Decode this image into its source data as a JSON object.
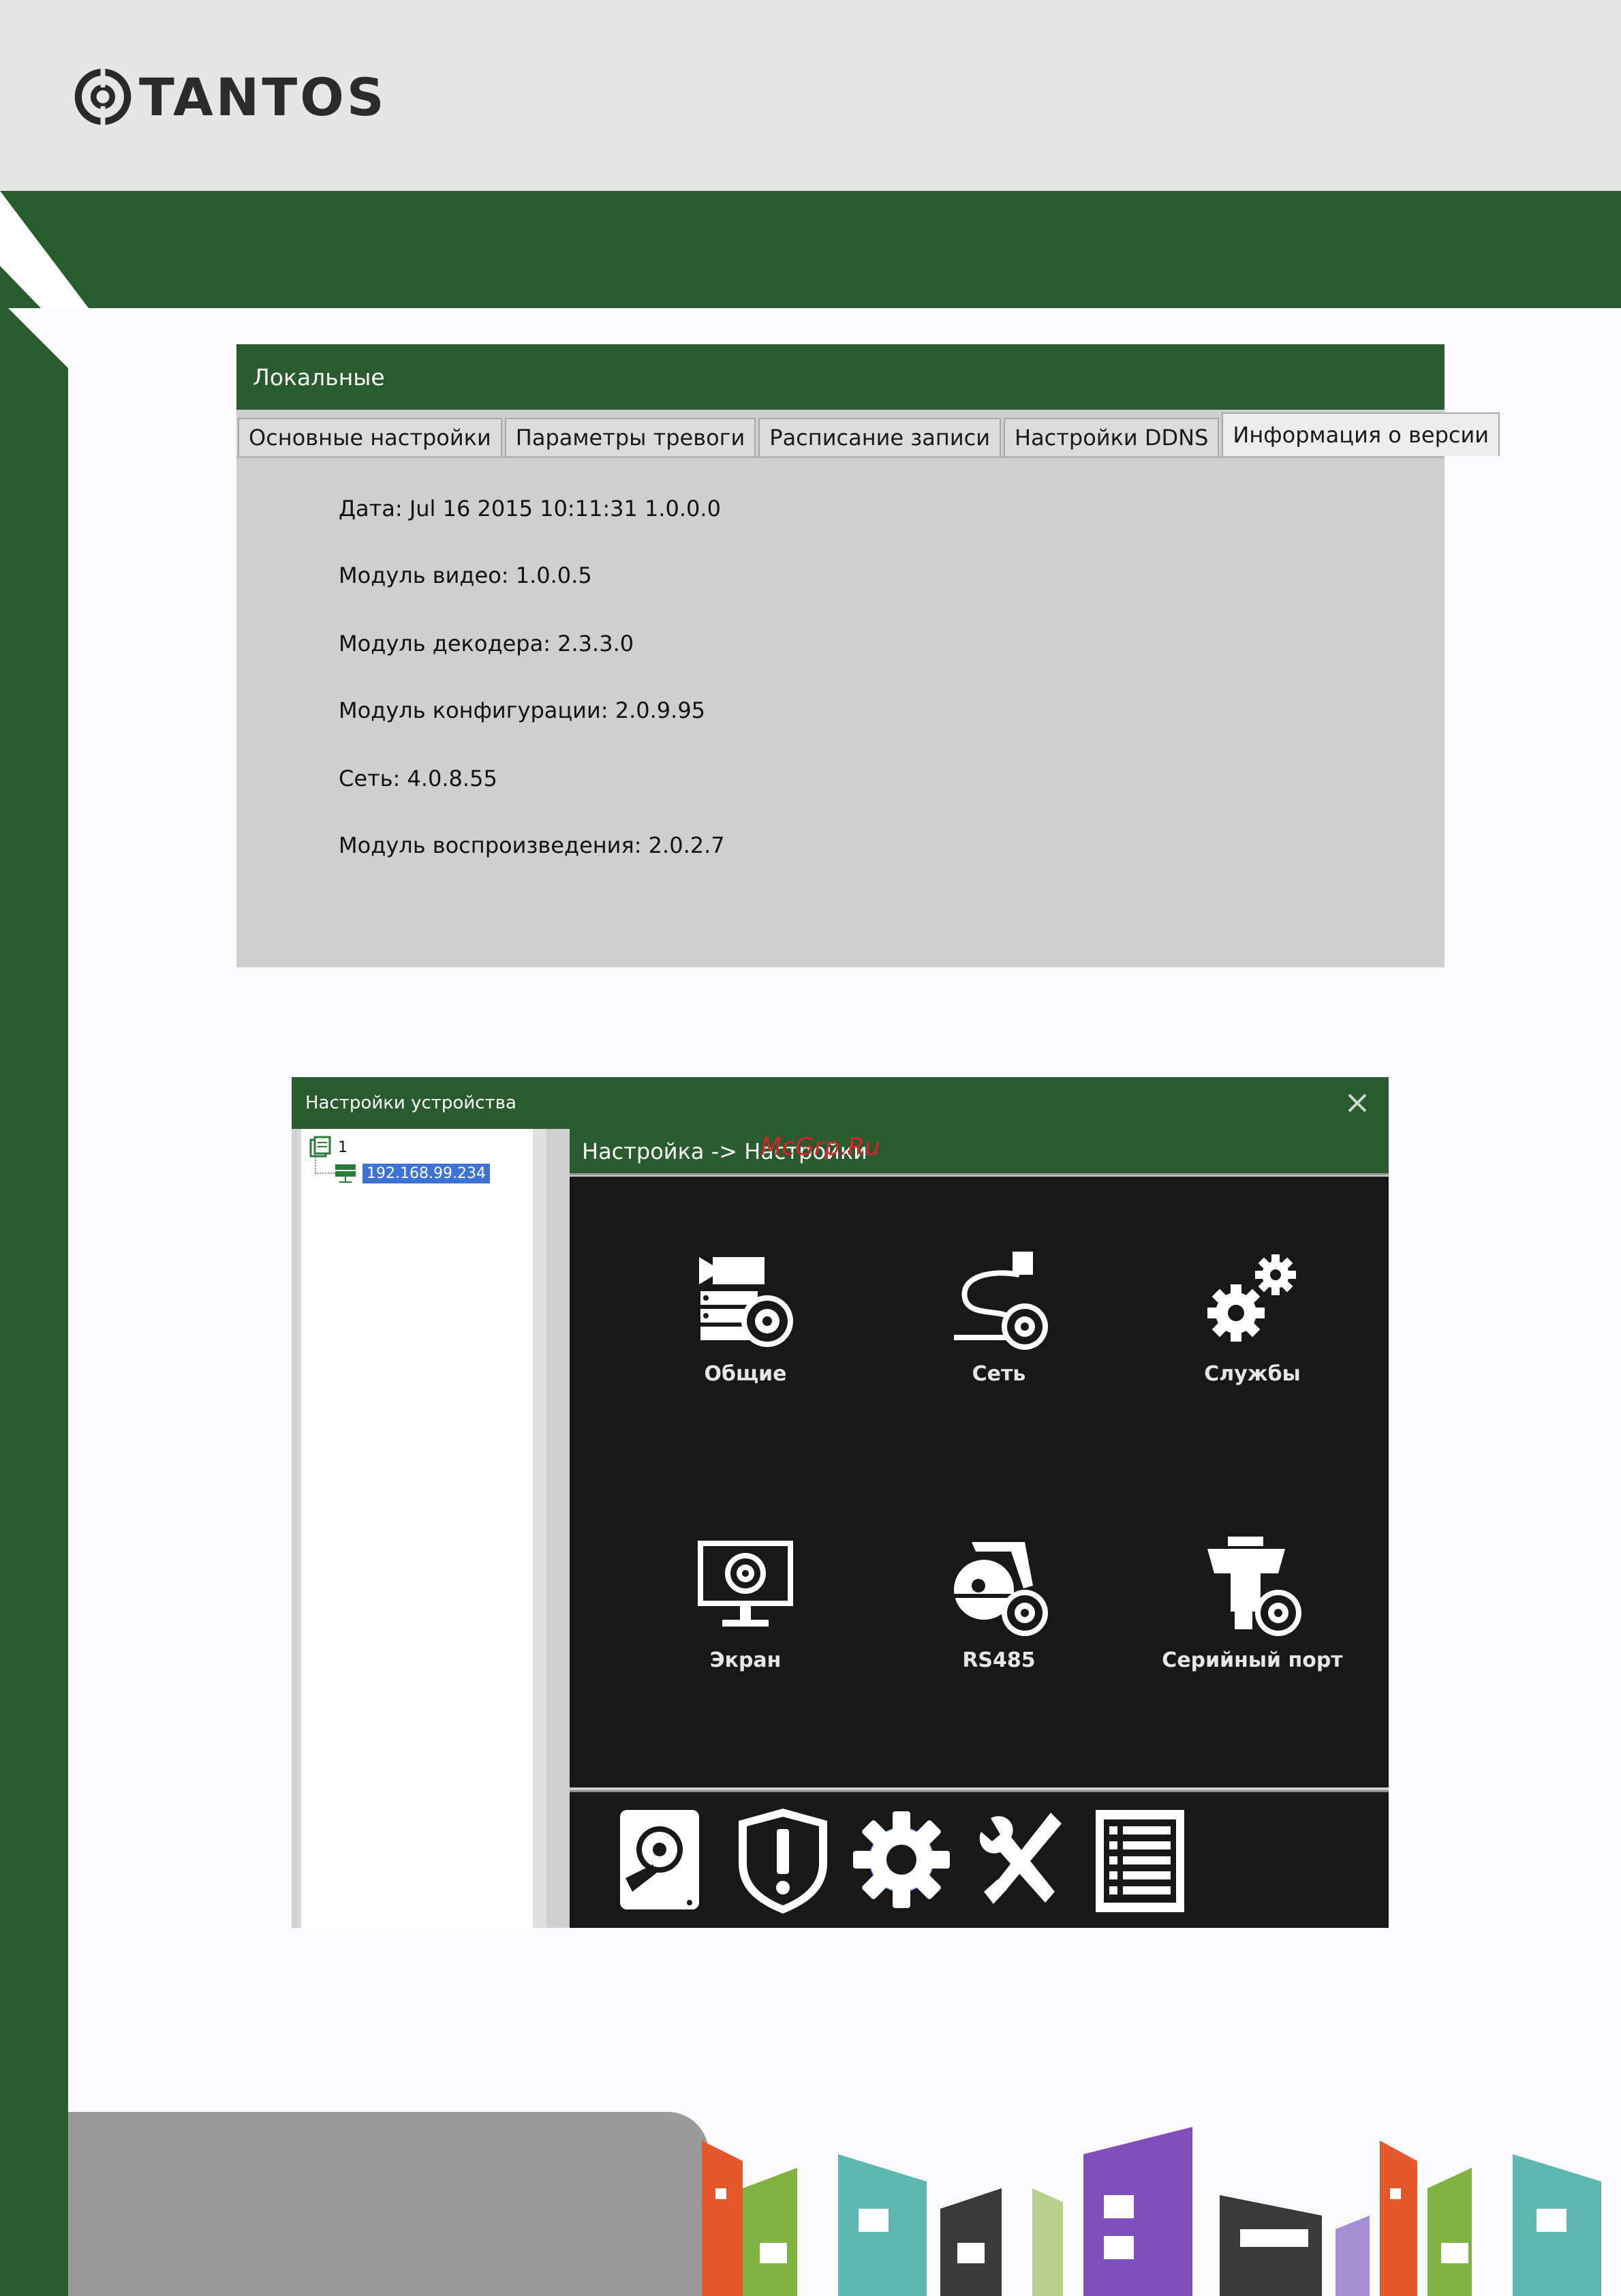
{
  "brand": {
    "name": "TANTOS",
    "color": "#2a5b2f"
  },
  "versionWindow": {
    "title": "Локальные",
    "tabs": [
      {
        "label": "Основные настройки"
      },
      {
        "label": "Параметры тревоги"
      },
      {
        "label": "Расписание записи"
      },
      {
        "label": "Настройки DDNS"
      },
      {
        "label": "Информация о версии",
        "active": true
      }
    ],
    "info": [
      "Дата: Jul 16 2015 10:11:31   1.0.0.0",
      "Модуль видео: 1.0.0.5",
      "Модуль декодера: 2.3.3.0",
      "Модуль конфигурации: 2.0.9.95",
      "Сеть: 4.0.8.55",
      "Модуль воспроизведения: 2.0.2.7"
    ]
  },
  "deviceWindow": {
    "title": "Настройки устройства",
    "tree": {
      "root": "1",
      "node": "192.168.99.234"
    },
    "breadcrumb": "Настройка -> Настройки",
    "watermark": "McGrp.Ru",
    "items": [
      {
        "label": "Общие",
        "icon": "camera-settings-icon"
      },
      {
        "label": "Сеть",
        "icon": "network-cable-icon"
      },
      {
        "label": "Службы",
        "icon": "gears-icon"
      },
      {
        "label": "Экран",
        "icon": "monitor-settings-icon"
      },
      {
        "label": "RS485",
        "icon": "ptz-camera-icon"
      },
      {
        "label": "Серийный порт",
        "icon": "serial-port-icon"
      }
    ],
    "bottomIcons": [
      "hdd-icon",
      "alarm-shield-icon",
      "settings-gear-icon",
      "tools-icon",
      "list-icon"
    ],
    "activeBottom": "settings-gear-icon"
  }
}
